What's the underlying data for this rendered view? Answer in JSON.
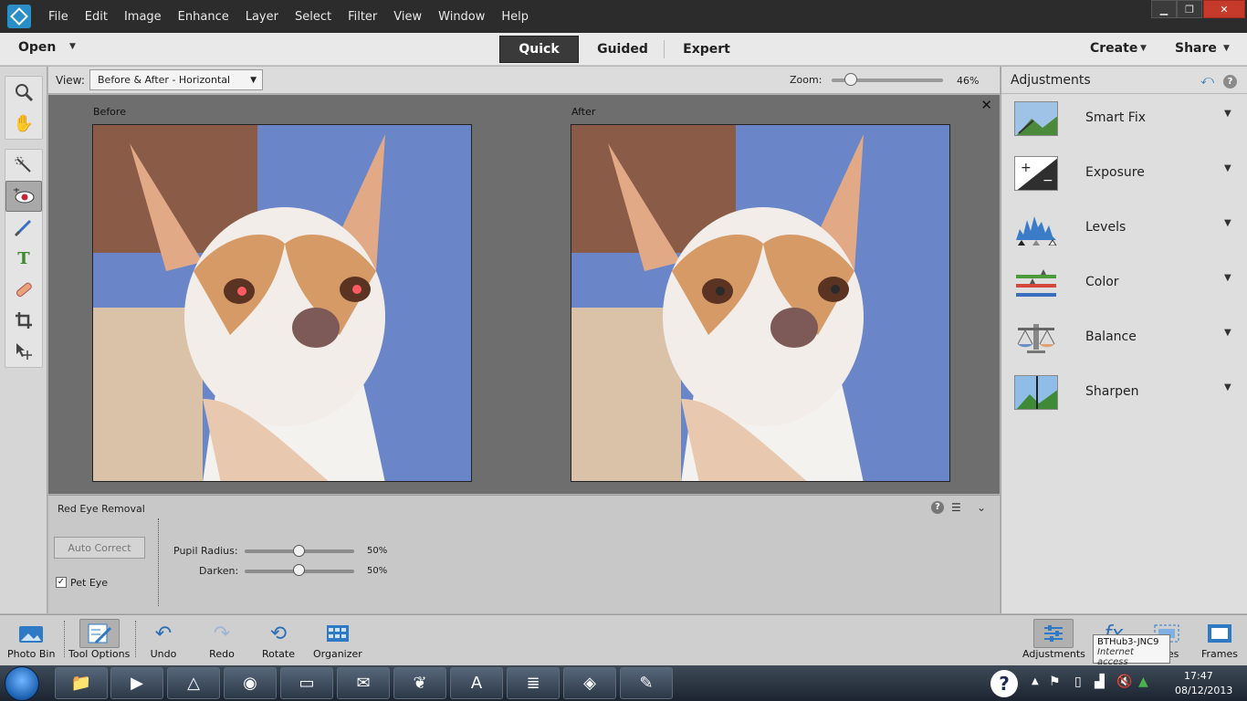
{
  "app": {
    "menu": [
      "File",
      "Edit",
      "Image",
      "Enhance",
      "Layer",
      "Select",
      "Filter",
      "View",
      "Window",
      "Help"
    ],
    "window_controls": {
      "minimize": "▁",
      "restore": "❐",
      "close": "✕"
    }
  },
  "modebar": {
    "open_label": "Open",
    "tabs": [
      {
        "label": "Quick"
      },
      {
        "label": "Guided"
      },
      {
        "label": "Expert"
      }
    ],
    "create_label": "Create",
    "share_label": "Share"
  },
  "viewbar": {
    "view_label": "View:",
    "view_value": "Before & After - Horizontal",
    "zoom_label": "Zoom:",
    "zoom_value": "46%"
  },
  "canvas": {
    "before_label": "Before",
    "after_label": "After",
    "close_icon": "✕"
  },
  "tool_options": {
    "title": "Red Eye Removal",
    "auto_correct_label": "Auto Correct",
    "pet_eye_label": "Pet Eye",
    "pet_eye_checked": true,
    "pupil_radius_label": "Pupil Radius:",
    "pupil_radius_value": "50%",
    "darken_label": "Darken:",
    "darken_value": "50%"
  },
  "adjustments": {
    "title": "Adjustments",
    "items": [
      {
        "label": "Smart Fix"
      },
      {
        "label": "Exposure"
      },
      {
        "label": "Levels"
      },
      {
        "label": "Color"
      },
      {
        "label": "Balance"
      },
      {
        "label": "Sharpen"
      }
    ]
  },
  "bottom_bar": {
    "photo_bin": "Photo Bin",
    "tool_options": "Tool Options",
    "undo": "Undo",
    "redo": "Redo",
    "rotate": "Rotate",
    "organizer": "Organizer",
    "adjustments": "Adjustments",
    "textures_partial": "res",
    "frames": "Frames"
  },
  "tooltip": {
    "title": "BTHub3-JNC9",
    "subtitle": "Internet access"
  },
  "windows_taskbar": {
    "time": "17:47",
    "date": "08/12/2013"
  },
  "colors": {
    "accent": "#2a8fc7",
    "canvas_bg": "#6e6e6e",
    "active_tab": "#3a3a3a"
  }
}
